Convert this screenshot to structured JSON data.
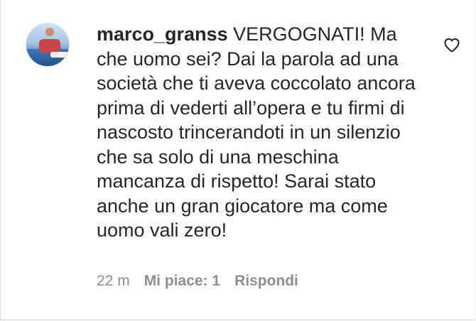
{
  "comment": {
    "username": "marco_granss",
    "text": "VERGOGNATI! Ma che uomo sei? Dai la parola ad una società che ti aveva coccolato ancora prima di vederti all’opera e tu firmi di nascosto trincerandoti in un silenzio che sa solo di una meschina mancanza di rispetto! Sarai stato anche un gran giocatore ma come uomo vali zero!"
  },
  "meta": {
    "time": "22 m",
    "likes": "Mi piace: 1",
    "reply": "Rispondi"
  },
  "icons": {
    "like": "heart-outline-icon",
    "avatar": "user-avatar"
  },
  "colors": {
    "text": "#262626",
    "secondary": "#8e8e8e"
  }
}
